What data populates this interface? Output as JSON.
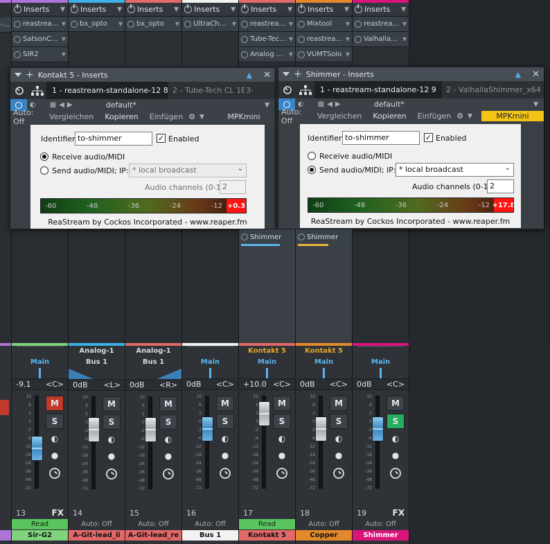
{
  "top_inserts": [
    {
      "label": "Inserts",
      "color": "#b073d8",
      "slots": [
        "reastream-s..",
        "SatsonChan..",
        "SIR2"
      ]
    },
    {
      "label": "Inserts",
      "color": "#3bb1e8",
      "slots": [
        "bx_opto"
      ]
    },
    {
      "label": "Inserts",
      "color": "#e26a6a",
      "slots": [
        "bx_opto"
      ]
    },
    {
      "label": "Inserts",
      "color": "#f0f0f0",
      "slots": [
        "UltraChannel"
      ]
    },
    {
      "label": "Inserts",
      "color": "#e26a6a",
      "slots": [
        "reastream-s..",
        "Tube-Tech..",
        "Analog Delay"
      ]
    },
    {
      "label": "Inserts",
      "color": "#e3892b",
      "slots": [
        "Mixtool",
        "reastream-s..",
        "VUMTSolo"
      ]
    },
    {
      "label": "Inserts",
      "color": "#d9147b",
      "slots": [
        "reastream-s..",
        "ValhallaShi.."
      ]
    }
  ],
  "left_edge_label": "-s..",
  "window1": {
    "title": "Kontakt 5 - Inserts",
    "slot_active": "1 - reastream-standalone-12 8",
    "slot_next": "2 - Tube-Tech CL 1B",
    "slot_more": "3-",
    "preset": "default*",
    "auto": "Auto: Off",
    "compare": "Vergleichen",
    "copy": "Kopieren",
    "paste": "Einfügen",
    "midi": "MPKmini",
    "identifier_label": "Identifier:",
    "identifier_value": "to-shimmer",
    "enabled_label": "Enabled",
    "receive_label": "Receive audio/MIDI",
    "send_label": "Send audio/MIDI; IP:",
    "ip_value": "* local broadcast",
    "channels_label": "Audio channels (0-12):",
    "channels_value": "2",
    "meter_ticks": [
      "-60",
      "-48",
      "-36",
      "-24",
      "-12"
    ],
    "peak": "+0.3",
    "meter_level": 0.95,
    "credit": "ReaStream by Cockos Incorporated - www.reaper.fm"
  },
  "window2": {
    "title": "Shimmer - Inserts",
    "slot_active": "1 - reastream-standalone-12 9",
    "slot_next": "2 - ValhallaShimmer_x64",
    "preset": "default*",
    "auto": "Auto: Off",
    "compare": "Vergleichen",
    "copy": "Kopieren",
    "paste": "Einfügen",
    "midi": "MPKmini",
    "identifier_label": "Identifier:",
    "identifier_value": "to-shimmer",
    "enabled_label": "Enabled",
    "receive_label": "Receive audio/MIDI",
    "send_label": "Send audio/MIDI; IP:",
    "ip_value": "* local broadcast",
    "channels_label": "Audio channels (0-12):",
    "channels_value": "2",
    "meter_ticks": [
      "-60",
      "-48",
      "-36",
      "-24",
      "-12"
    ],
    "peak": "+17.8",
    "meter_level": 0.97,
    "credit": "ReaStream by Cockos Incorporated - www.reaper.fm"
  },
  "sends": [
    {
      "label": "Shimmer"
    },
    {
      "label": "Shimmer"
    }
  ],
  "channels": [
    {
      "instr": "",
      "bus": "",
      "main": "Main",
      "vol": "-9.1",
      "pan": "<C>",
      "num": "13",
      "tag": "FX",
      "auto": "Read",
      "auto_on": true,
      "name": "Sir-G2",
      "color": "#7fd37a",
      "m_red": true,
      "s_green": false,
      "fader_blue": true,
      "fader_level": 0.42
    },
    {
      "instr": "Analog-1",
      "bus": "Bus 1",
      "main": "",
      "vol": "0dB",
      "pan": "<L>",
      "num": "14",
      "tag": "",
      "auto": "Auto: Off",
      "auto_on": false,
      "name": "A-Git-lead_li",
      "color": "#e36868",
      "m_red": false,
      "s_green": false,
      "fader_blue": false,
      "fader_level": 0.7
    },
    {
      "instr": "Analog-1",
      "bus": "Bus 1",
      "main": "",
      "vol": "0dB",
      "pan": "<R>",
      "num": "15",
      "tag": "",
      "auto": "Auto: Off",
      "auto_on": false,
      "name": "A-Git-lead_re",
      "color": "#e36868",
      "m_red": false,
      "s_green": false,
      "fader_blue": false,
      "fader_level": 0.7
    },
    {
      "instr": "",
      "bus": "",
      "main": "Main",
      "vol": "0dB",
      "pan": "<C>",
      "num": "16",
      "tag": "",
      "auto": "Auto: Off",
      "auto_on": false,
      "name": "Bus 1",
      "color": "#f2f2f2",
      "m_red": false,
      "s_green": false,
      "fader_blue": true,
      "fader_level": 0.7
    },
    {
      "instr": "Kontakt 5",
      "bus": "",
      "main": "Main",
      "vol": "+10.0",
      "pan": "<C>",
      "num": "17",
      "tag": "",
      "auto": "Read",
      "auto_on": true,
      "name": "Kontakt 5",
      "color": "#e36868",
      "m_red": false,
      "s_green": false,
      "fader_blue": false,
      "fader_level": 0.92
    },
    {
      "instr": "Kontakt 5",
      "bus": "",
      "main": "Main",
      "vol": "0dB",
      "pan": "<C>",
      "num": "18",
      "tag": "",
      "auto": "Auto: Off",
      "auto_on": false,
      "name": "Copper",
      "color": "#e3892b",
      "m_red": false,
      "s_green": false,
      "fader_blue": false,
      "fader_level": 0.7
    },
    {
      "instr": "",
      "bus": "",
      "main": "Main",
      "vol": "0dB",
      "pan": "<C>",
      "num": "19",
      "tag": "FX",
      "auto": "Auto: Off",
      "auto_on": false,
      "name": "Shimmer",
      "color": "#d9147b",
      "m_red": false,
      "s_green": true,
      "fader_blue": true,
      "fader_level": 0.7
    }
  ],
  "scale_ticks": [
    "10",
    "6",
    "2",
    "0",
    "-2",
    "-6",
    "-12",
    "-18",
    "-24",
    "-36",
    "-48",
    "-72"
  ]
}
